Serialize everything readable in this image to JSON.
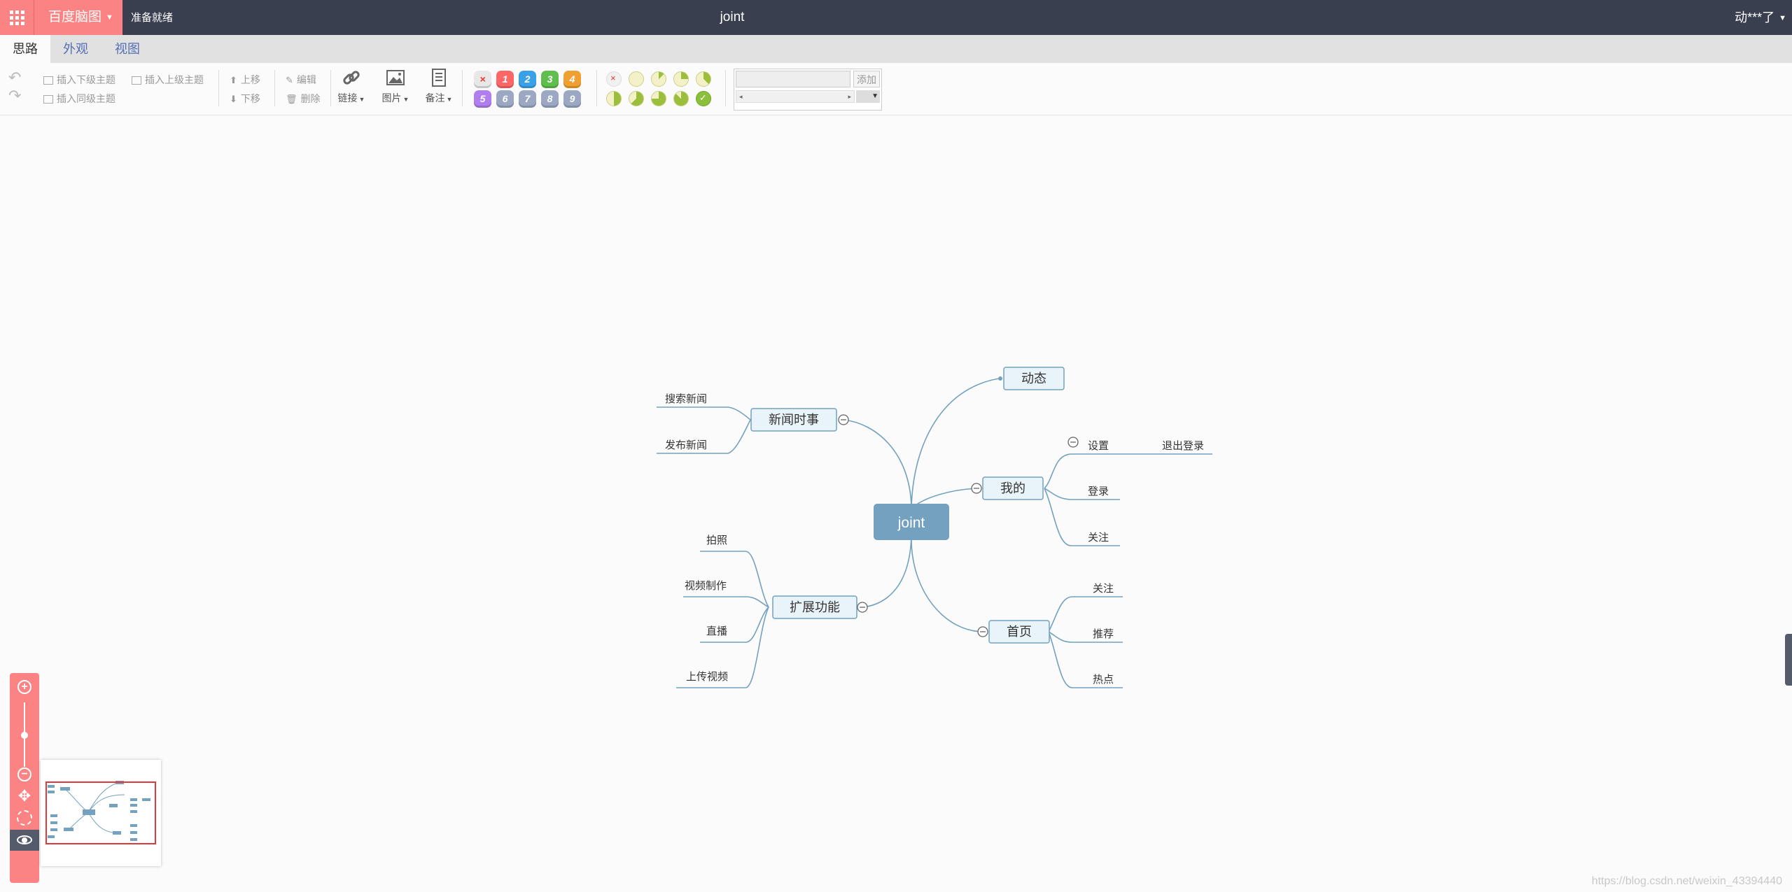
{
  "topbar": {
    "brand": "百度脑图",
    "status": "准备就绪",
    "title": "joint",
    "user": "动***了"
  },
  "tabs": [
    {
      "label": "思路",
      "active": true
    },
    {
      "label": "外观",
      "active": false
    },
    {
      "label": "视图",
      "active": false
    }
  ],
  "toolbar": {
    "insert_child": "插入下级主题",
    "insert_parent": "插入上级主题",
    "insert_sibling": "插入同级主题",
    "move_up": "上移",
    "move_down": "下移",
    "edit": "编辑",
    "delete": "删除",
    "link": "链接",
    "image": "图片",
    "note": "备注",
    "resource_add": "添加",
    "priorities": [
      "×",
      "1",
      "2",
      "3",
      "4",
      "5",
      "6",
      "7",
      "8",
      "9"
    ],
    "priority_colors": [
      "#e8e8e8",
      "#ff6666",
      "#3aa0e8",
      "#5fbe4e",
      "#f0a030",
      "#b17ef0",
      "#9ba7c3",
      "#9ba7c3",
      "#9ba7c3",
      "#9ba7c3"
    ],
    "progress_levels": [
      "×",
      "0",
      "1",
      "2",
      "3",
      "4",
      "5",
      "6",
      "7",
      "8",
      "done"
    ]
  },
  "mindmap": {
    "root": "joint",
    "nodes": {
      "news": "新闻时事",
      "news_search": "搜索新闻",
      "news_publish": "发布新闻",
      "dynamic": "动态",
      "mine": "我的",
      "settings": "设置",
      "logout": "退出登录",
      "login": "登录",
      "follow_mine": "关注",
      "extend": "扩展功能",
      "photo": "拍照",
      "video_make": "视频制作",
      "live": "直播",
      "upload_video": "上传视频",
      "home": "首页",
      "home_follow": "关注",
      "recommend": "推荐",
      "hot": "热点"
    },
    "colors": {
      "root_fill": "#73a1bf",
      "line": "#73a1bf",
      "node_fill": "#e9f3fa"
    }
  },
  "watermark": "https://blog.csdn.net/weixin_43394440"
}
